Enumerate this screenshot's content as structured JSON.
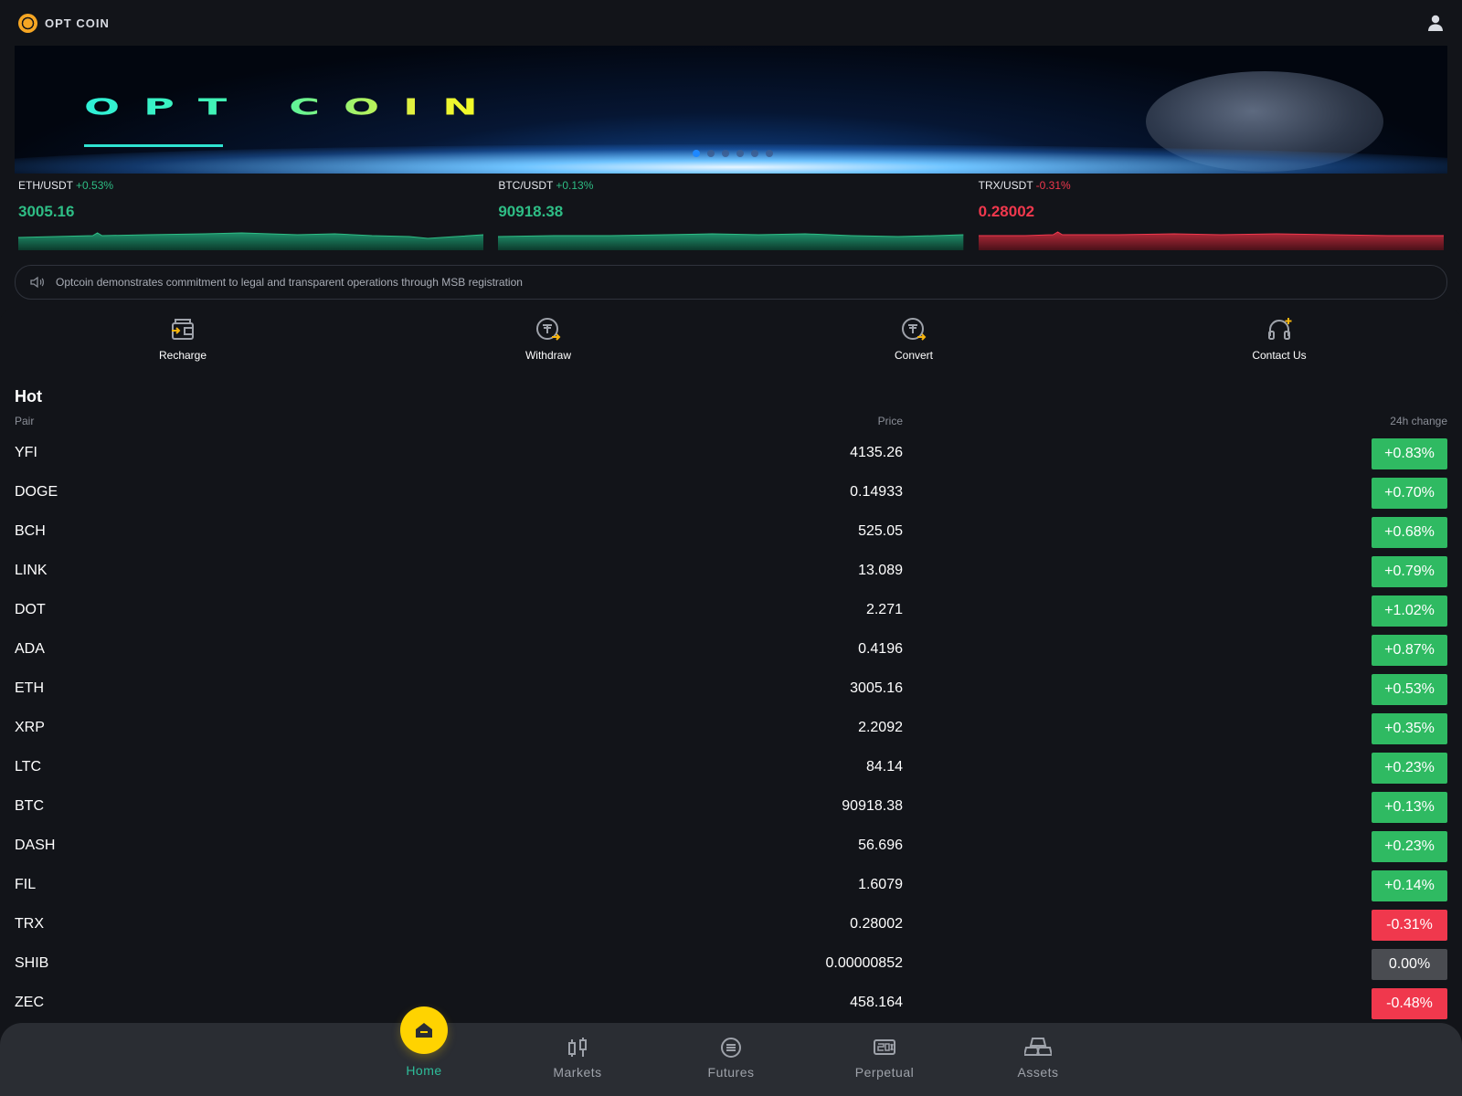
{
  "header": {
    "brand_name": "OPT COIN",
    "user_icon": "user-icon"
  },
  "banner": {
    "title": "OPT COIN",
    "slide_count": 6,
    "active_slide": 1
  },
  "tickers": [
    {
      "pair": "ETH/USDT",
      "change": "+0.53%",
      "price": "3005.16",
      "trend": "up"
    },
    {
      "pair": "BTC/USDT",
      "change": "+0.13%",
      "price": "90918.38",
      "trend": "up"
    },
    {
      "pair": "TRX/USDT",
      "change": "-0.31%",
      "price": "0.28002",
      "trend": "down"
    }
  ],
  "notice": {
    "icon": "speaker-icon",
    "text": "Optcoin demonstrates commitment to legal and transparent operations through MSB registration"
  },
  "quick_actions": [
    {
      "label": "Recharge",
      "icon": "recharge-icon"
    },
    {
      "label": "Withdraw",
      "icon": "withdraw-icon"
    },
    {
      "label": "Convert",
      "icon": "convert-icon"
    },
    {
      "label": "Contact Us",
      "icon": "headset-icon"
    }
  ],
  "hot": {
    "title": "Hot",
    "columns": {
      "pair": "Pair",
      "price": "Price",
      "change": "24h change"
    },
    "rows": [
      {
        "pair": "YFI",
        "price": "4135.26",
        "change": "+0.83%",
        "trend": "up"
      },
      {
        "pair": "DOGE",
        "price": "0.14933",
        "change": "+0.70%",
        "trend": "up"
      },
      {
        "pair": "BCH",
        "price": "525.05",
        "change": "+0.68%",
        "trend": "up"
      },
      {
        "pair": "LINK",
        "price": "13.089",
        "change": "+0.79%",
        "trend": "up"
      },
      {
        "pair": "DOT",
        "price": "2.271",
        "change": "+1.02%",
        "trend": "up"
      },
      {
        "pair": "ADA",
        "price": "0.4196",
        "change": "+0.87%",
        "trend": "up"
      },
      {
        "pair": "ETH",
        "price": "3005.16",
        "change": "+0.53%",
        "trend": "up"
      },
      {
        "pair": "XRP",
        "price": "2.2092",
        "change": "+0.35%",
        "trend": "up"
      },
      {
        "pair": "LTC",
        "price": "84.14",
        "change": "+0.23%",
        "trend": "up"
      },
      {
        "pair": "BTC",
        "price": "90918.38",
        "change": "+0.13%",
        "trend": "up"
      },
      {
        "pair": "DASH",
        "price": "56.696",
        "change": "+0.23%",
        "trend": "up"
      },
      {
        "pair": "FIL",
        "price": "1.6079",
        "change": "+0.14%",
        "trend": "up"
      },
      {
        "pair": "TRX",
        "price": "0.28002",
        "change": "-0.31%",
        "trend": "down"
      },
      {
        "pair": "SHIB",
        "price": "0.00000852",
        "change": "0.00%",
        "trend": "flat"
      },
      {
        "pair": "ZEC",
        "price": "458.164",
        "change": "-0.48%",
        "trend": "down"
      }
    ]
  },
  "bottom_nav": [
    {
      "label": "Home",
      "icon": "home-icon",
      "active": true
    },
    {
      "label": "Markets",
      "icon": "markets-icon",
      "active": false
    },
    {
      "label": "Futures",
      "icon": "futures-icon",
      "active": false
    },
    {
      "label": "Perpetual",
      "icon": "perpetual-icon",
      "active": false
    },
    {
      "label": "Assets",
      "icon": "assets-icon",
      "active": false
    }
  ],
  "colors": {
    "up": "#2ebd85",
    "down": "#f0384d",
    "flat": "#4a4c51",
    "accent": "#ffd300",
    "background": "#121419"
  }
}
